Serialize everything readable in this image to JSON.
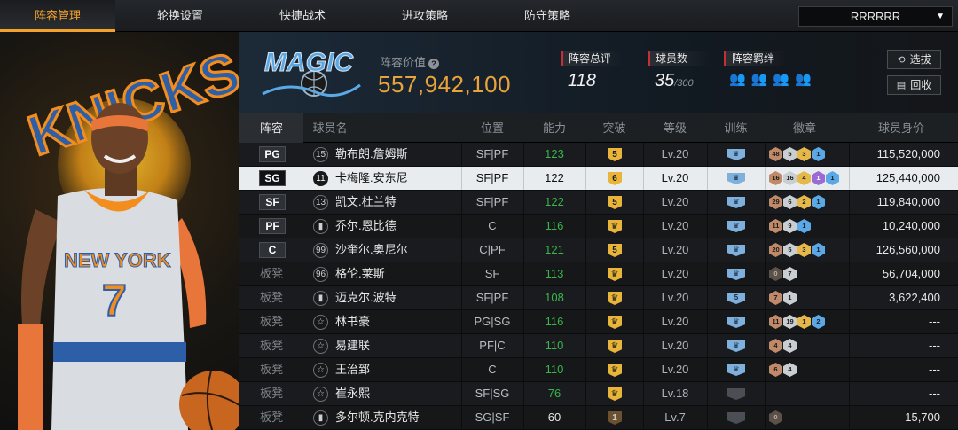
{
  "nav": {
    "tabs": [
      "阵容管理",
      "轮换设置",
      "快捷战术",
      "进攻策略",
      "防守策略"
    ],
    "active_tab": 0,
    "team_select": "RRRRRR"
  },
  "header": {
    "value_label": "阵容价值",
    "team_value": "557,942,100",
    "overall_label": "阵容总评",
    "overall_value": "118",
    "players_label": "球员数",
    "players_value": "35",
    "players_max": "/300",
    "chem_label": "阵容羁绊",
    "select_button": "选拔",
    "recycle_button": "回收"
  },
  "table": {
    "headers": [
      "阵容",
      "球员名",
      "位置",
      "能力",
      "突破",
      "等级",
      "训练",
      "徽章",
      "球员身价"
    ],
    "rows": [
      {
        "slot": "PG",
        "num": "15",
        "name": "勒布朗.詹姆斯",
        "position": "SF|PF",
        "ability": "123",
        "ability_color": "g",
        "breakthrough": "5",
        "level": "Lv.20",
        "training": "crown",
        "badges": [
          [
            "48",
            "b"
          ],
          [
            "5",
            "s"
          ],
          [
            "3",
            "go"
          ],
          [
            "1",
            "bl"
          ]
        ],
        "salary": "115,520,000"
      },
      {
        "slot": "SG",
        "num": "11",
        "name": "卡梅隆.安东尼",
        "position": "SF|PF",
        "ability": "122",
        "ability_color": "w",
        "breakthrough": "6",
        "level": "Lv.20",
        "training": "crown",
        "badges": [
          [
            "16",
            "b"
          ],
          [
            "16",
            "s"
          ],
          [
            "4",
            "go"
          ],
          [
            "1",
            "p"
          ],
          [
            "1",
            "bl"
          ]
        ],
        "salary": "125,440,000",
        "selected": true
      },
      {
        "slot": "SF",
        "num": "13",
        "name": "凯文.杜兰特",
        "position": "SF|PF",
        "ability": "122",
        "ability_color": "g",
        "breakthrough": "5",
        "level": "Lv.20",
        "training": "crown",
        "badges": [
          [
            "29",
            "b"
          ],
          [
            "6",
            "s"
          ],
          [
            "2",
            "go"
          ],
          [
            "1",
            "bl"
          ]
        ],
        "salary": "119,840,000"
      },
      {
        "slot": "PF",
        "num": "",
        "name": "乔尔.恩比德",
        "position": "C",
        "ability": "116",
        "ability_color": "g",
        "breakthrough": "crown",
        "level": "Lv.20",
        "training": "crown",
        "badges": [
          [
            "11",
            "b"
          ],
          [
            "9",
            "s"
          ],
          [
            "1",
            "bl"
          ]
        ],
        "salary": "10,240,000"
      },
      {
        "slot": "C",
        "num": "99",
        "name": "沙奎尔.奥尼尔",
        "position": "C|PF",
        "ability": "121",
        "ability_color": "g",
        "breakthrough": "5",
        "level": "Lv.20",
        "training": "crown",
        "badges": [
          [
            "20",
            "b"
          ],
          [
            "5",
            "s"
          ],
          [
            "3",
            "go"
          ],
          [
            "1",
            "bl"
          ]
        ],
        "salary": "126,560,000"
      },
      {
        "slot": "板凳",
        "num": "96",
        "name": "格伦.莱斯",
        "position": "SF",
        "ability": "113",
        "ability_color": "g",
        "breakthrough": "crown",
        "level": "Lv.20",
        "training": "crown",
        "badges": [
          [
            "0",
            "dk"
          ],
          [
            "7",
            "s"
          ]
        ],
        "salary": "56,704,000"
      },
      {
        "slot": "板凳",
        "num": "",
        "name": "迈克尔.波特",
        "position": "SF|PF",
        "ability": "108",
        "ability_color": "g",
        "breakthrough": "crown",
        "level": "Lv.20",
        "training": "5",
        "badges": [
          [
            "7",
            "b"
          ],
          [
            "1",
            "s"
          ]
        ],
        "salary": "3,622,400"
      },
      {
        "slot": "板凳",
        "num": "",
        "name": "林书豪",
        "position": "PG|SG",
        "ability": "116",
        "ability_color": "g",
        "breakthrough": "crown",
        "level": "Lv.20",
        "training": "crown",
        "badges": [
          [
            "11",
            "b"
          ],
          [
            "19",
            "s"
          ],
          [
            "1",
            "go"
          ],
          [
            "2",
            "bl"
          ]
        ],
        "salary": "---"
      },
      {
        "slot": "板凳",
        "num": "",
        "name": "易建联",
        "position": "PF|C",
        "ability": "110",
        "ability_color": "g",
        "breakthrough": "crown",
        "level": "Lv.20",
        "training": "crown",
        "badges": [
          [
            "4",
            "b"
          ],
          [
            "4",
            "s"
          ]
        ],
        "salary": "---"
      },
      {
        "slot": "板凳",
        "num": "",
        "name": "王治郅",
        "position": "C",
        "ability": "110",
        "ability_color": "g",
        "breakthrough": "crown",
        "level": "Lv.20",
        "training": "crown",
        "badges": [
          [
            "6",
            "b"
          ],
          [
            "4",
            "s"
          ]
        ],
        "salary": "---"
      },
      {
        "slot": "板凳",
        "num": "",
        "name": "崔永熙",
        "position": "SF|SG",
        "ability": "76",
        "ability_color": "g",
        "breakthrough": "crown",
        "level": "Lv.18",
        "training": "dim",
        "badges": [],
        "salary": "---"
      },
      {
        "slot": "板凳",
        "num": "",
        "name": "多尔顿.克内克特",
        "position": "SG|SF",
        "ability": "60",
        "ability_color": "w",
        "breakthrough": "1",
        "level": "Lv.7",
        "training": "dim",
        "badges": [
          [
            "0",
            "dk"
          ]
        ],
        "salary": "15,700"
      }
    ]
  },
  "art": {
    "jersey_text": "NEW YORK",
    "jersey_number": "7",
    "banner_text": "KNICKS",
    "logo_text": "MAGIC",
    "accent": "#f4a12c",
    "gold": "#e9a33a"
  }
}
